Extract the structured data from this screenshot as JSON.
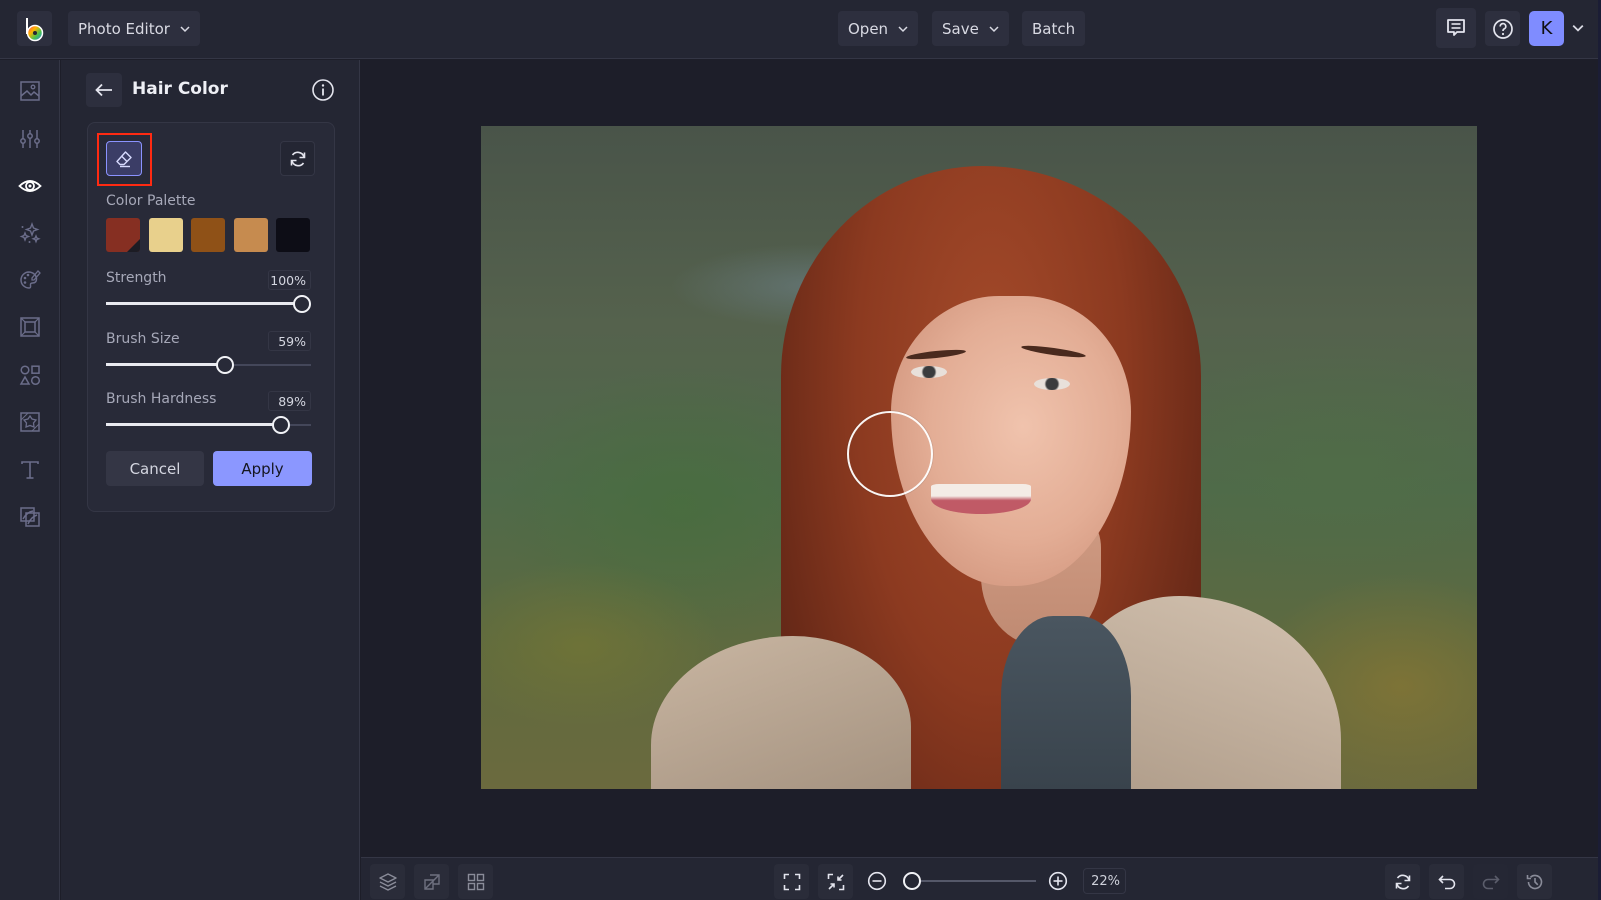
{
  "app": {
    "name": "BeFunky",
    "mode_label": "Photo Editor"
  },
  "topbar": {
    "open_label": "Open",
    "save_label": "Save",
    "batch_label": "Batch",
    "feedback_icon": "message-square-icon",
    "help_icon": "help-circle-icon",
    "avatar_initial": "K",
    "accent_color": "#7f8cff"
  },
  "rail": {
    "items": [
      {
        "id": "image-manager",
        "icon": "image-icon",
        "active": false
      },
      {
        "id": "edit",
        "icon": "sliders-icon",
        "active": false
      },
      {
        "id": "touch-up",
        "icon": "eye-icon",
        "active": true
      },
      {
        "id": "effects",
        "icon": "sparkles-icon",
        "active": false
      },
      {
        "id": "artsy",
        "icon": "palette-icon",
        "active": false
      },
      {
        "id": "frames",
        "icon": "frame-icon",
        "active": false
      },
      {
        "id": "graphics",
        "icon": "shapes-icon",
        "active": false
      },
      {
        "id": "textures",
        "icon": "texture-icon",
        "active": false
      },
      {
        "id": "text",
        "icon": "text-icon",
        "active": false
      },
      {
        "id": "overlays",
        "icon": "overlay-icon",
        "active": false
      }
    ]
  },
  "panel": {
    "title": "Hair Color",
    "palette_label": "Color Palette",
    "palette": [
      {
        "color": "#862f22",
        "selected": true
      },
      {
        "color": "#e8d08c",
        "selected": false
      },
      {
        "color": "#8f5117",
        "selected": false
      },
      {
        "color": "#c68b4f",
        "selected": false
      },
      {
        "color": "#0d0d16",
        "selected": false
      }
    ],
    "sliders": [
      {
        "id": "strength",
        "label": "Strength",
        "value": 100,
        "display": "100%"
      },
      {
        "id": "brush-size",
        "label": "Brush Size",
        "value": 59,
        "display": "59%"
      },
      {
        "id": "brush-hardness",
        "label": "Brush Hardness",
        "value": 89,
        "display": "89%"
      }
    ],
    "cancel_label": "Cancel",
    "apply_label": "Apply",
    "apply_color": "#8b97ff"
  },
  "canvas": {
    "image_description": "Portrait of a smiling red-haired woman with freckles, beige coat, blurred green outdoor background"
  },
  "bottombar": {
    "zoom_value": 22,
    "zoom_display": "22%"
  }
}
